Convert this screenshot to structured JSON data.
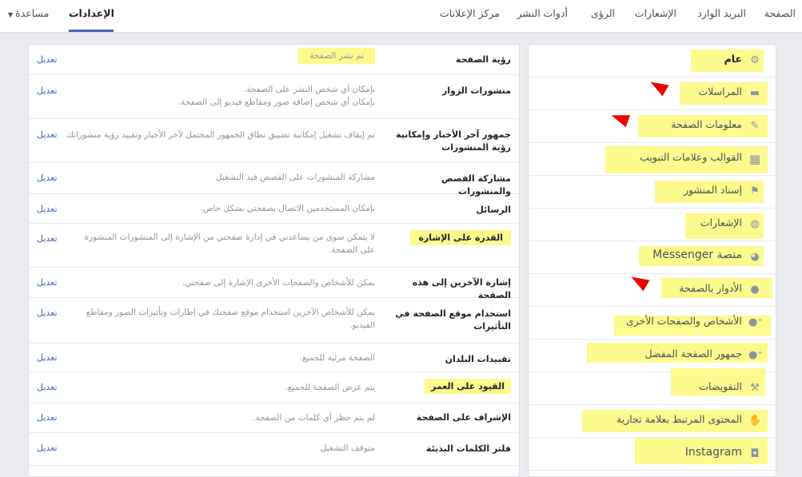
{
  "topnav": {
    "page": "الصفحة",
    "inbox": "البريد الوارد",
    "notifications": "الإشعارات",
    "insights": "الرؤى",
    "publishing_tools": "أدوات النشر",
    "ad_center": "مركز الإعلانات",
    "settings": "الإعدادات",
    "help": "مساعدة"
  },
  "sidebar": {
    "items": [
      {
        "label": "عام",
        "icon": "gear-icon"
      },
      {
        "label": "المراسلات",
        "icon": "messages-icon"
      },
      {
        "label": "معلومات الصفحة",
        "icon": "pencil-icon"
      },
      {
        "label": "القوالب وعلامات التبويب",
        "icon": "grid-icon"
      },
      {
        "label": "إسناد المنشور",
        "icon": "flag-icon"
      },
      {
        "label": "الإشعارات",
        "icon": "globe-icon"
      },
      {
        "label": "منصة Messenger",
        "icon": "messenger-icon"
      },
      {
        "label": "الأدوار بالصفحة",
        "icon": "person-icon"
      },
      {
        "label": "الأشخاص والصفحات الأخرى",
        "icon": "people-icon"
      },
      {
        "label": "جمهور الصفحة المفضل",
        "icon": "audience-icon"
      },
      {
        "label": "التفويضات",
        "icon": "wrench-icon"
      },
      {
        "label": "المحتوى المرتبط بعلامة تجارية",
        "icon": "handshake-icon"
      },
      {
        "label": "Instagram",
        "icon": "instagram-icon"
      }
    ]
  },
  "settings": {
    "edit_label": "تعديل",
    "rows": [
      {
        "name": "رؤية الصفحة",
        "value": "تم نشر الصفحة"
      },
      {
        "name": "منشورات الزوار",
        "value": "بإمكان أي شخص النشر على الصفحة.",
        "value2": "بإمكان أي شخص إضافة صور ومقاطع فيديو إلى الصفحة."
      },
      {
        "name": "جمهور آخر الأخبار وإمكانية رؤية المنشورات",
        "value": "تم إيقاف تشغيل إمكانية تضييق نطاق الجمهور المحتمل لآخر الأخبار وتقييد رؤية منشوراتك"
      },
      {
        "name": "مشاركة القصص والمنشورات",
        "value": "مشاركة المنشورات على القصص قيد التشغيل"
      },
      {
        "name": "الرسائل",
        "value": "بإمكان المستخدمين الاتصال بصفحتي بشكل خاص."
      },
      {
        "name": "القدرة على الإشارة",
        "value": "لا يتمكن سوى من يساعدني في إدارة صفحتي من الإشارة إلى المنشورات المنشورة على الصفحة."
      },
      {
        "name": "إشارة الآخرين إلى هذه الصفحة",
        "value": "يمكن للأشخاص والصفحات الأخرى الإشارة إلى صفحتي."
      },
      {
        "name": "استخدام موقع الصفحة في التأثيرات",
        "value": "يمكن للأشخاص الآخرين استخدام موقع صفحتك في إطارات وتأثيرات الصور ومقاطع الفيديو."
      },
      {
        "name": "تقييدات البلدان",
        "value": "الصفحة مرئية للجميع."
      },
      {
        "name": "القيود على العمر",
        "value": "يتم عرض الصفحة للجميع."
      },
      {
        "name": "الإشراف على الصفحة",
        "value": "لم يتم حظر أي كلمات من الصفحة."
      },
      {
        "name": "فلتر الكلمات البذيئة",
        "value": "متوقف التشغيل"
      }
    ]
  }
}
